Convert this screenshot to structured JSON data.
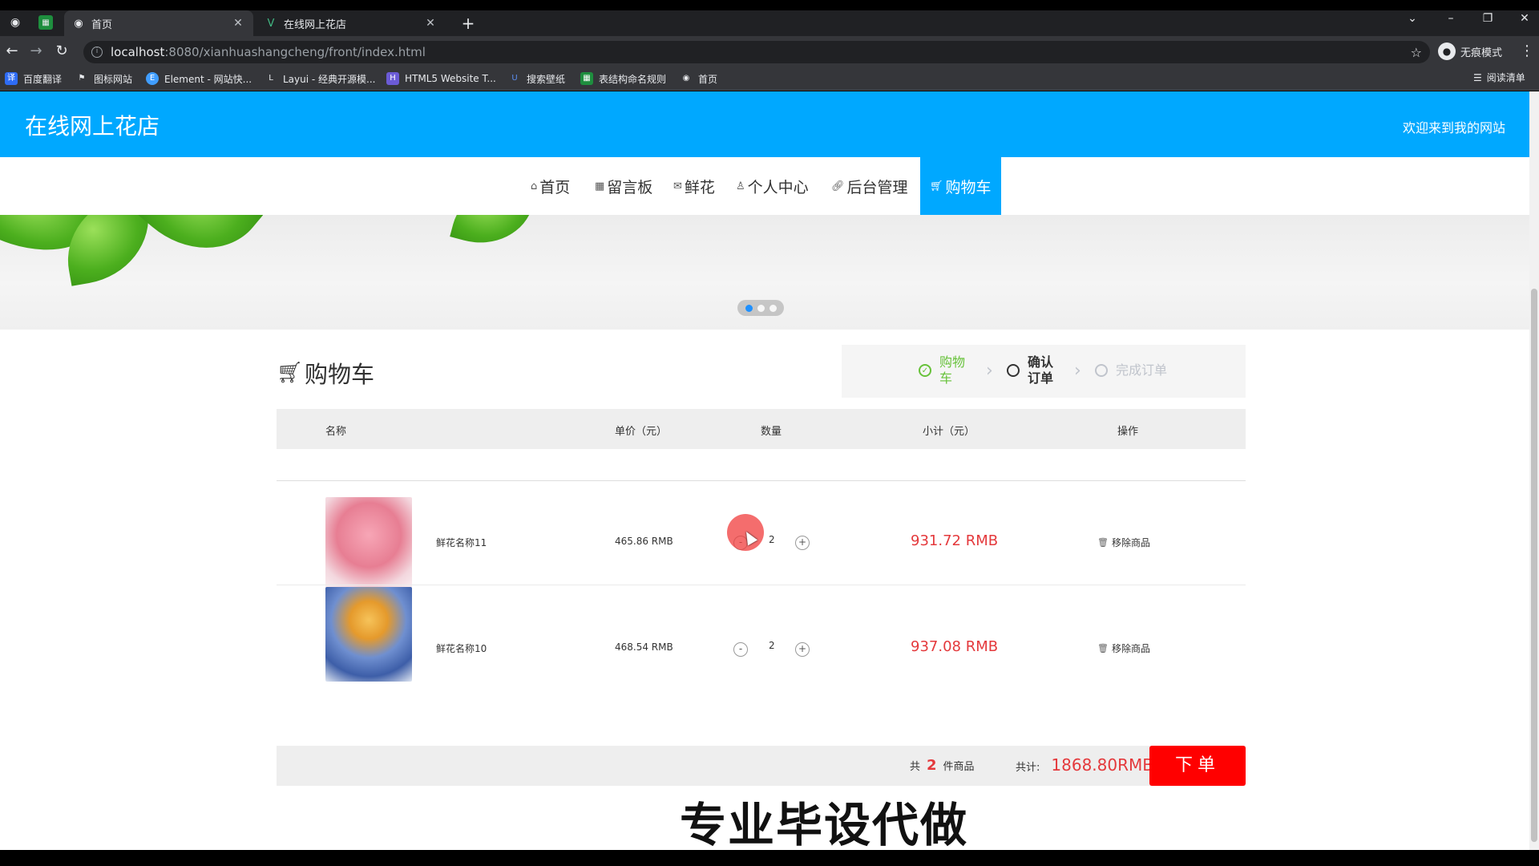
{
  "browser": {
    "tabs": [
      {
        "title": "首页",
        "active": true
      },
      {
        "title": "在线网上花店",
        "active": false
      }
    ],
    "url_host": "localhost",
    "url_rest": ":8080/xianhuashangcheng/front/index.html",
    "incognito_label": "无痕模式",
    "bookmarks": [
      "百度翻译",
      "图标网站",
      "Element - 网站快...",
      "Layui - 经典开源模...",
      "HTML5 Website T...",
      "搜索壁纸",
      "表结构命名规则",
      "首页"
    ],
    "reading_list": "阅读清单"
  },
  "site": {
    "title": "在线网上花店",
    "welcome": "欢迎来到我的网站",
    "accent": "#00a8ff"
  },
  "nav": {
    "items": [
      {
        "label": "首页",
        "icon": "home-icon"
      },
      {
        "label": "留言板",
        "icon": "message-icon"
      },
      {
        "label": "鲜花",
        "icon": "mail-icon"
      },
      {
        "label": "个人中心",
        "icon": "user-icon"
      },
      {
        "label": "后台管理",
        "icon": "link-icon"
      },
      {
        "label": "购物车",
        "icon": "cart-icon",
        "active": true
      }
    ]
  },
  "carousel": {
    "slides": 3,
    "active_index": 0
  },
  "cart": {
    "title": "购物车",
    "steps": [
      {
        "label": "购物车",
        "state": "done"
      },
      {
        "label": "确认订单",
        "state": "current"
      },
      {
        "label": "完成订单",
        "state": "todo"
      }
    ],
    "columns": [
      "名称",
      "单价（元）",
      "数量",
      "小计（元）",
      "操作"
    ],
    "items": [
      {
        "name": "鲜花名称11",
        "price": "465.86 RMB",
        "minus": "-",
        "qty": "2",
        "plus": "+",
        "subtotal": "931.72 RMB",
        "remove": "移除商品"
      },
      {
        "name": "鲜花名称10",
        "price": "468.54 RMB",
        "minus": "-",
        "qty": "2",
        "plus": "+",
        "subtotal": "937.08 RMB",
        "remove": "移除商品"
      }
    ],
    "summary": {
      "count_prefix": "共",
      "count": "2",
      "count_suffix": "件商品",
      "total_label": "共计:",
      "total_value": "1868.80RMB"
    },
    "order_button": "下单"
  },
  "watermark": "专业毕设代做"
}
